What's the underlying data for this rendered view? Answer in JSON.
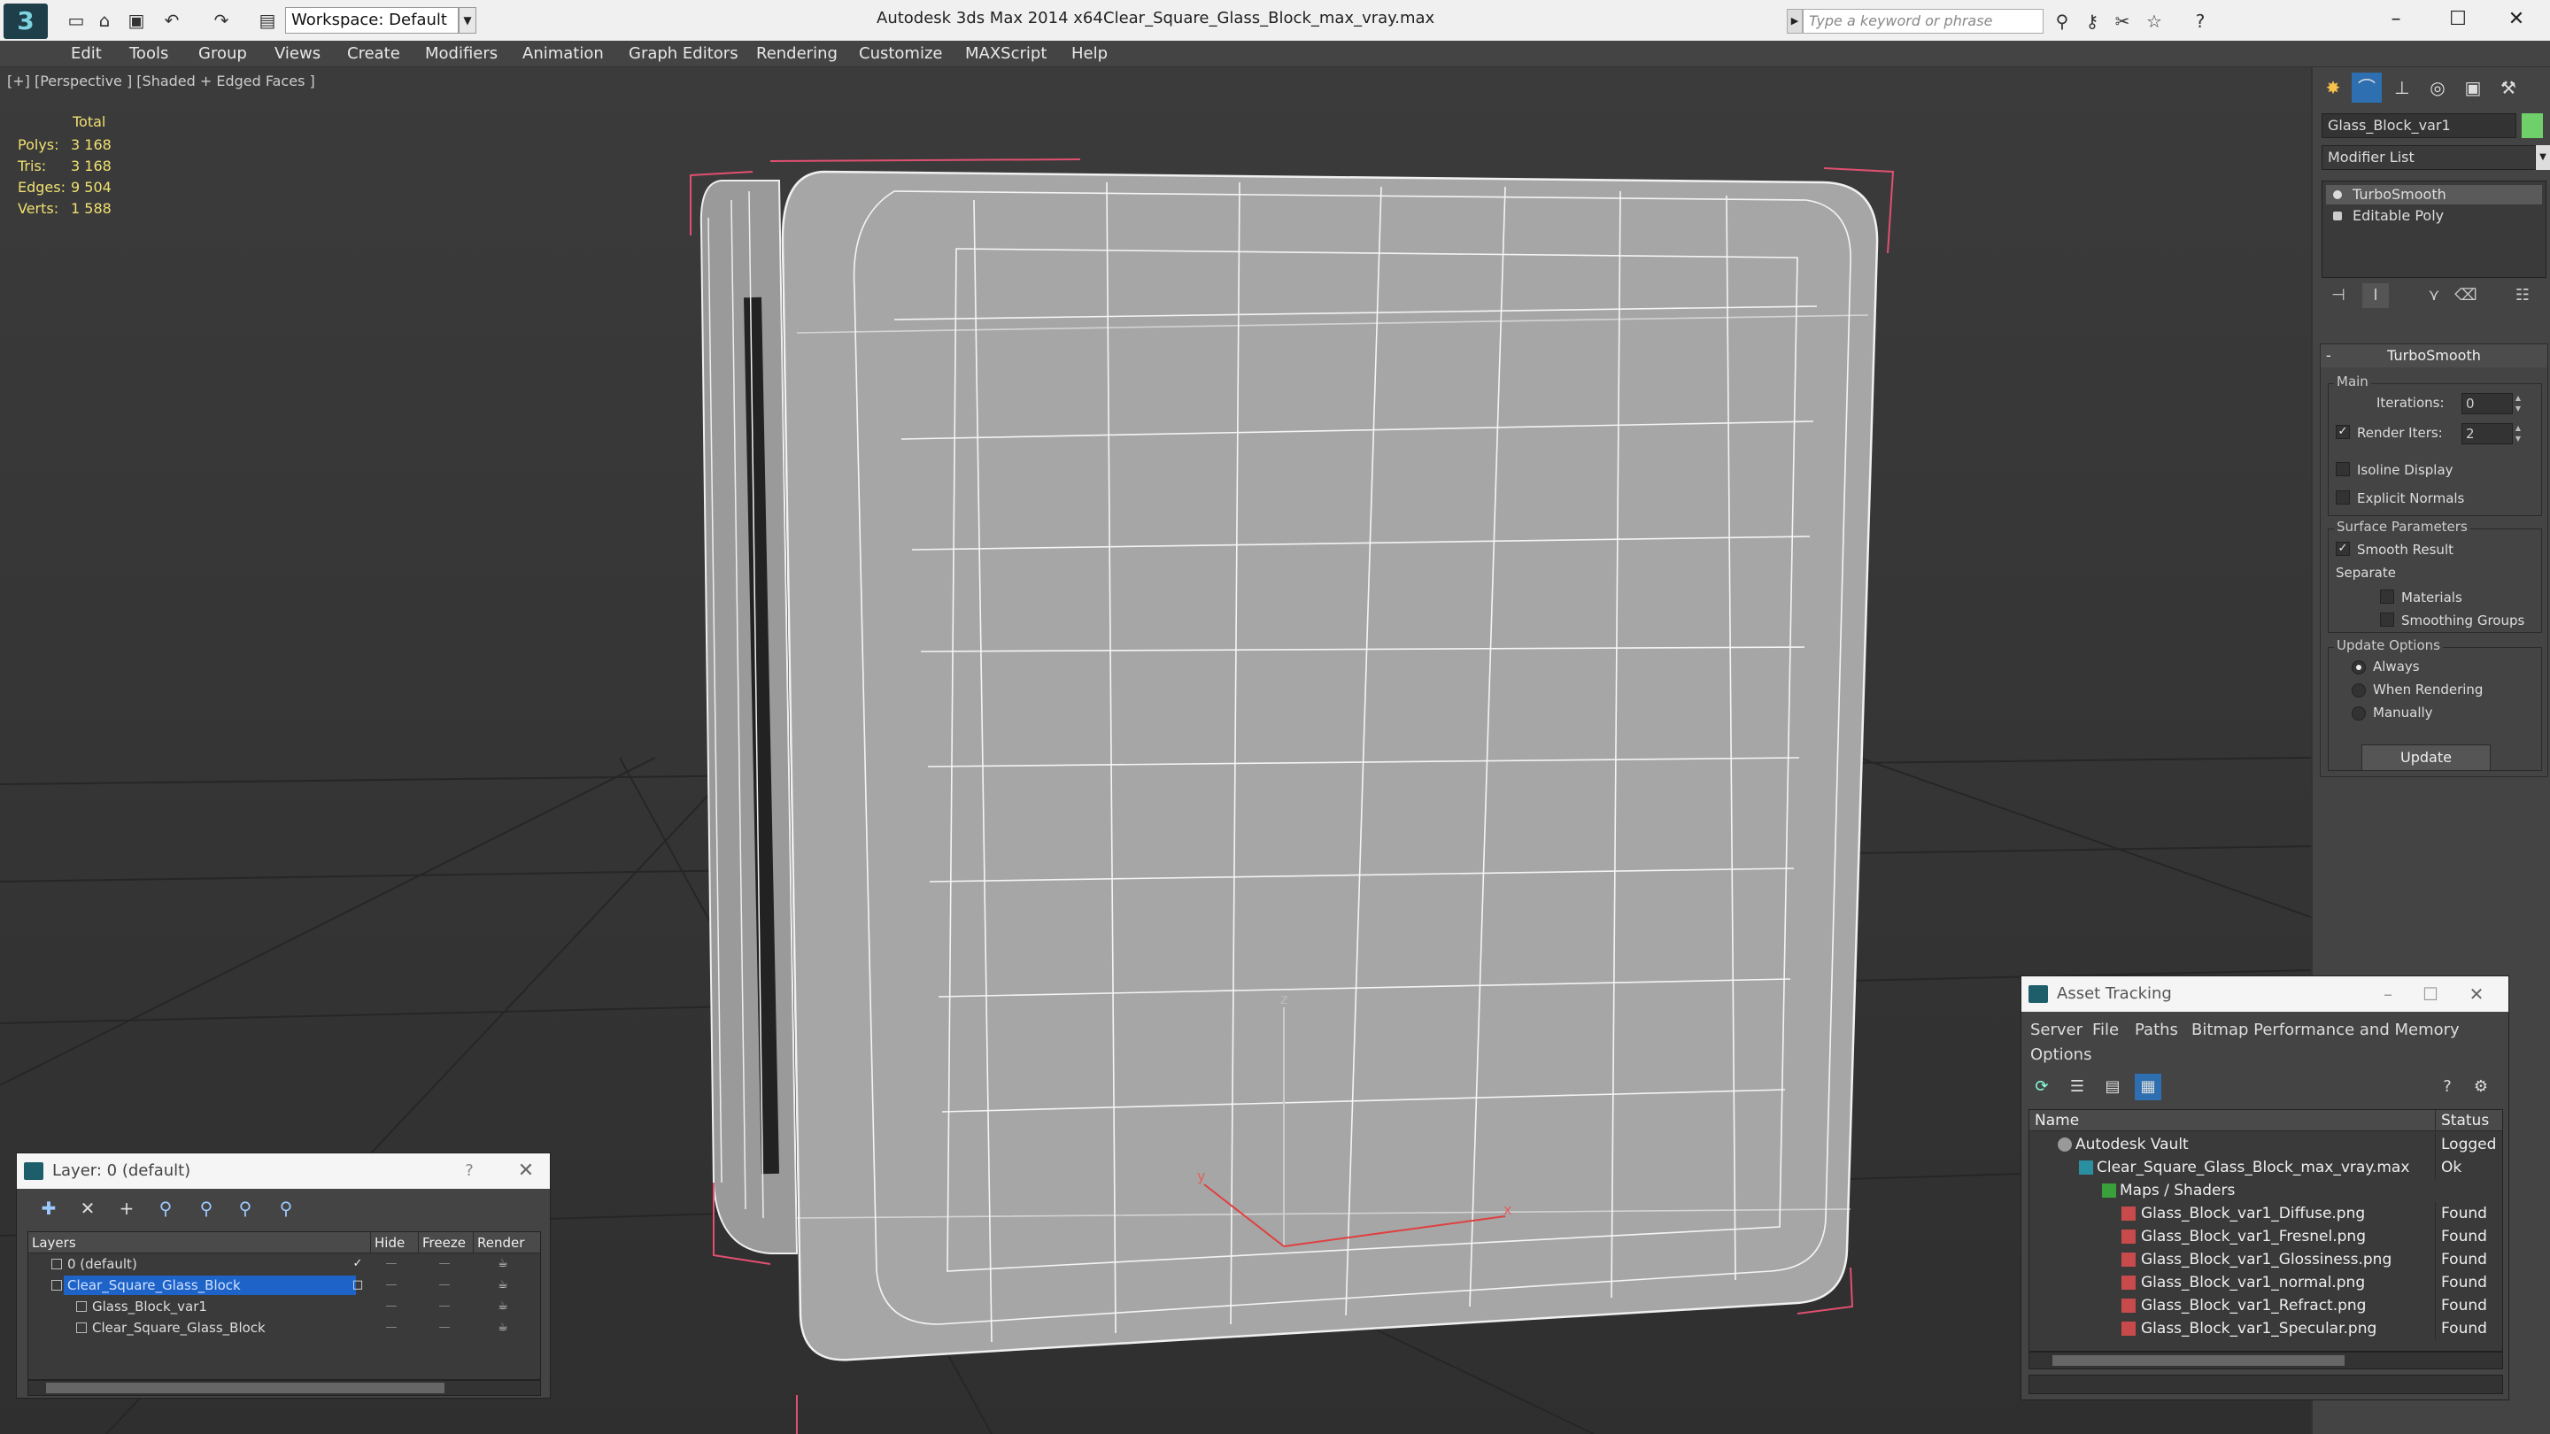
{
  "window": {
    "app_title": "Autodesk 3ds Max  2014 x64",
    "file_title": "Clear_Square_Glass_Block_max_vray.max",
    "workspace": "Workspace: Default",
    "search_placeholder": "Type a keyword or phrase"
  },
  "menu": [
    "Edit",
    "Tools",
    "Group",
    "Views",
    "Create",
    "Modifiers",
    "Animation",
    "Graph Editors",
    "Rendering",
    "Customize",
    "MAXScript",
    "Help"
  ],
  "viewport": {
    "label": "[+] [Perspective ] [Shaded + Edged Faces ]",
    "stats_header": "Total",
    "stats": [
      {
        "label": "Polys:",
        "value": "3 168"
      },
      {
        "label": "Tris:",
        "value": "3 168"
      },
      {
        "label": "Edges:",
        "value": "9 504"
      },
      {
        "label": "Verts:",
        "value": "1 588"
      }
    ],
    "axis": {
      "x": "x",
      "y": "y",
      "z": "z"
    }
  },
  "command_panel": {
    "object_name": "Glass_Block_var1",
    "object_color": "#6fd06a",
    "modifier_list": "Modifier List",
    "stack": [
      "TurboSmooth",
      "Editable Poly"
    ],
    "turbosmooth": {
      "title": "TurboSmooth",
      "main_group": "Main",
      "iterations_label": "Iterations:",
      "iterations_value": "0",
      "render_iters_label": "Render Iters:",
      "render_iters_value": "2",
      "isoline_label": "Isoline Display",
      "explicit_normals_label": "Explicit Normals",
      "surface_group": "Surface Parameters",
      "smooth_result_label": "Smooth Result",
      "separate_label": "Separate",
      "materials_label": "Materials",
      "smoothing_groups_label": "Smoothing Groups",
      "update_group": "Update Options",
      "always_label": "Always",
      "when_rendering_label": "When Rendering",
      "manually_label": "Manually",
      "update_button": "Update"
    }
  },
  "layer_window": {
    "title": "Layer: 0 (default)",
    "help": "?",
    "columns": [
      "Layers",
      "Hide",
      "Freeze",
      "Render"
    ],
    "rows": [
      {
        "name": "0 (default)",
        "indent": 0
      },
      {
        "name": "Clear_Square_Glass_Block",
        "indent": 0,
        "selected": true
      },
      {
        "name": "Glass_Block_var1",
        "indent": 1
      },
      {
        "name": "Clear_Square_Glass_Block",
        "indent": 1
      }
    ]
  },
  "asset_tracking": {
    "title": "Asset Tracking",
    "menu": [
      "Server",
      "File",
      "Paths",
      "Bitmap Performance and Memory",
      "Options"
    ],
    "columns": [
      "Name",
      "Status"
    ],
    "rows": [
      {
        "name": "Autodesk Vault",
        "status": "Logged",
        "indent": 0
      },
      {
        "name": "Clear_Square_Glass_Block_max_vray.max",
        "status": "Ok",
        "indent": 1
      },
      {
        "name": "Maps / Shaders",
        "status": "",
        "indent": 2
      },
      {
        "name": "Glass_Block_var1_Diffuse.png",
        "status": "Found",
        "indent": 3
      },
      {
        "name": "Glass_Block_var1_Fresnel.png",
        "status": "Found",
        "indent": 3
      },
      {
        "name": "Glass_Block_var1_Glossiness.png",
        "status": "Found",
        "indent": 3
      },
      {
        "name": "Glass_Block_var1_normal.png",
        "status": "Found",
        "indent": 3
      },
      {
        "name": "Glass_Block_var1_Refract.png",
        "status": "Found",
        "indent": 3
      },
      {
        "name": "Glass_Block_var1_Specular.png",
        "status": "Found",
        "indent": 3
      }
    ]
  }
}
